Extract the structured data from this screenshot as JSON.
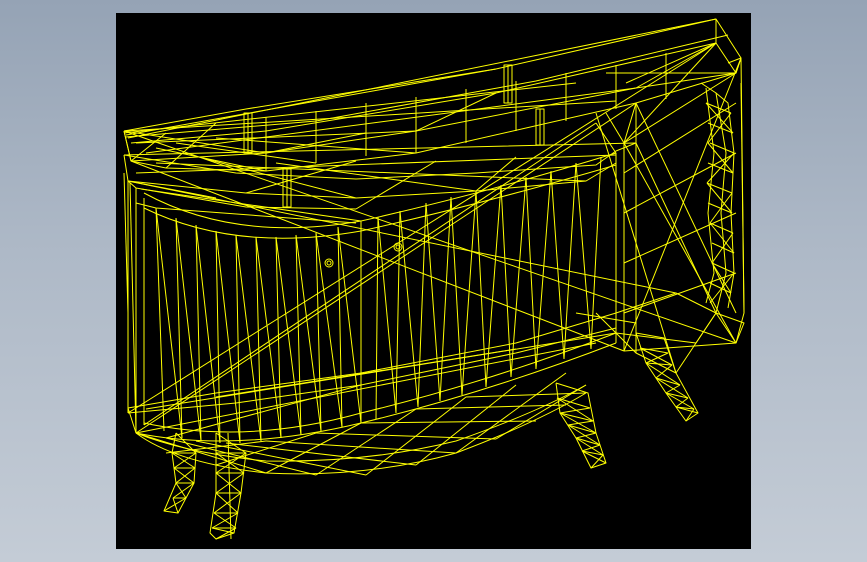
{
  "viewport": {
    "background": "#000000",
    "wire_color": "#ffff00",
    "model": "sideboard-cabinet-wireframe"
  },
  "page": {
    "background_top": "#95a3b5",
    "background_bottom": "#c4ccd6"
  }
}
